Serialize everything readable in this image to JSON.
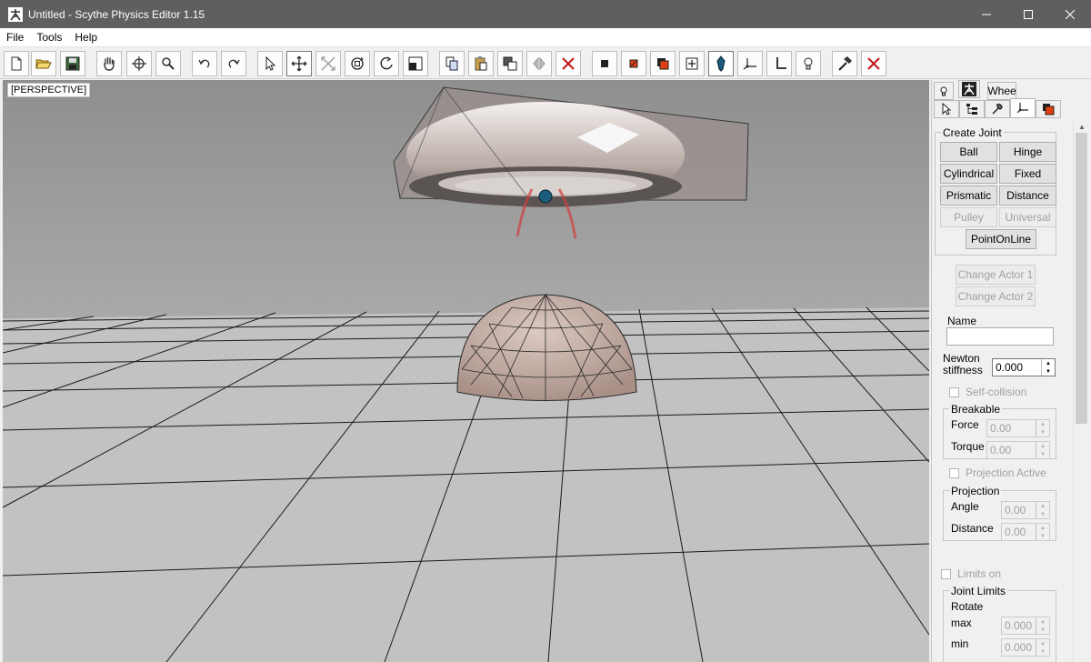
{
  "window": {
    "title": "Untitled - Scythe Physics Editor 1.15",
    "controls": [
      "minimize-icon",
      "maximize-icon",
      "close-icon"
    ]
  },
  "menu": {
    "items": [
      "File",
      "Tools",
      "Help"
    ]
  },
  "toolbar": {
    "buttons": [
      "new-file-icon",
      "open-folder-icon",
      "save-icon",
      "pan-hand-icon",
      "orbit-icon",
      "zoom-icon",
      "undo-icon",
      "redo-icon",
      "select-arrow-icon",
      "move-icon",
      "scale-icon",
      "rotate-local-icon",
      "rotate-icon",
      "resize-icon",
      "copy-icon",
      "paste-icon",
      "clone-icon",
      "mirror-icon",
      "delete-icon",
      "box-actor-icon",
      "sphere-actor-icon",
      "mesh-actor-icon",
      "add-shape-icon",
      "joint-anchor-icon",
      "joint-axis-icon",
      "joint-frame-icon",
      "light-icon",
      "hammer-icon",
      "remove-icon"
    ]
  },
  "viewport": {
    "label": "[PERSPECTIVE]"
  },
  "panel": {
    "tabs_row1": [
      "light-tab-icon",
      "scythe-tab-icon",
      "Whee"
    ],
    "tabs_row2": [
      "select-tab-icon",
      "hierarchy-tab-icon",
      "tools-tab-icon",
      "joint-tab-icon",
      "material-tab-icon"
    ],
    "create_joint": {
      "title": "Create Joint",
      "buttons": [
        "Ball",
        "Hinge",
        "Cylindrical",
        "Fixed",
        "Prismatic",
        "Distance",
        "Pulley",
        "Universal",
        "PointOnLine"
      ]
    },
    "change_actor1": "Change Actor 1",
    "change_actor2": "Change Actor 2",
    "name_label": "Name",
    "name_value": "",
    "newton_label_1": "Newton",
    "newton_label_2": "stiffness",
    "newton_value": "0.000",
    "self_collision": "Self-collision",
    "breakable": {
      "title": "Breakable",
      "force_label": "Force",
      "force_value": "0.00",
      "torque_label": "Torque",
      "torque_value": "0.00"
    },
    "projection_active": "Projection Active",
    "projection": {
      "title": "Projection",
      "angle_label": "Angle",
      "angle_value": "0.00",
      "distance_label": "Distance",
      "distance_value": "0.00"
    },
    "limits_on": "Limits on",
    "joint_limits": {
      "title": "Joint Limits",
      "rotate_label": "Rotate",
      "max_label": "max",
      "max_value": "0.000",
      "min_label": "min",
      "min_value": "0.000"
    }
  },
  "colors": {
    "titlebar": "#5f5f5f",
    "viewport_sky": "#a3a3a3",
    "grid_floor": "#c0c0c0",
    "actor_tint": "#b8a49c"
  }
}
